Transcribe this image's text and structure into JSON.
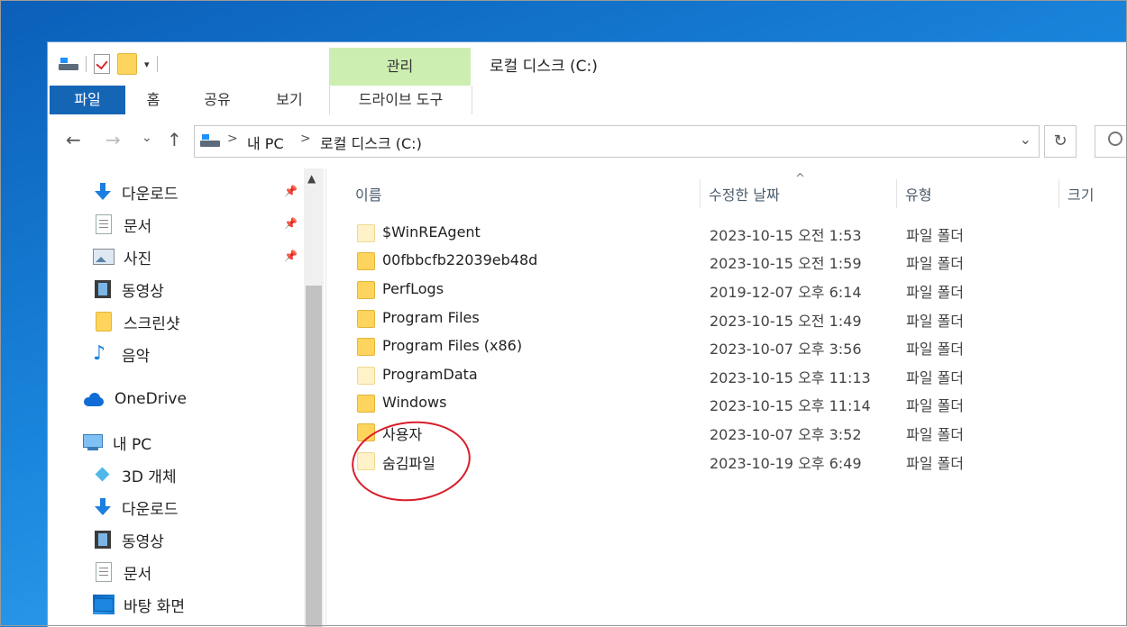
{
  "title": {
    "manage_tab": "관리",
    "window_title": "로컬 디스크 (C:)"
  },
  "ribbon": {
    "tabs": [
      "파일",
      "홈",
      "공유",
      "보기",
      "드라이브 도구"
    ]
  },
  "address": {
    "crumbs": [
      "내 PC",
      "로컬 디스크 (C:)"
    ],
    "separator": ">",
    "back": "←",
    "forward": "→",
    "recent": "⌄",
    "up": "↑",
    "dropdown": "⌄",
    "refresh": "↻"
  },
  "nav": {
    "quick": [
      {
        "label": "다운로드",
        "icon": "download-icon",
        "pinned": true
      },
      {
        "label": "문서",
        "icon": "document-icon",
        "pinned": true
      },
      {
        "label": "사진",
        "icon": "picture-icon",
        "pinned": true
      },
      {
        "label": "동영상",
        "icon": "video-icon",
        "pinned": false
      },
      {
        "label": "스크린샷",
        "icon": "folder-icon",
        "pinned": false
      },
      {
        "label": "음악",
        "icon": "music-icon",
        "pinned": false
      }
    ],
    "onedrive": "OneDrive",
    "pc": "내 PC",
    "pc_items": [
      {
        "label": "3D 개체",
        "icon": "3d-objects-icon"
      },
      {
        "label": "다운로드",
        "icon": "download-icon"
      },
      {
        "label": "동영상",
        "icon": "video-icon"
      },
      {
        "label": "문서",
        "icon": "document-icon"
      },
      {
        "label": "바탕 화면",
        "icon": "desktop-icon"
      }
    ],
    "pin_glyph": "📌",
    "scroll_up": "▲"
  },
  "list": {
    "columns": [
      "이름",
      "수정한 날짜",
      "유형",
      "크기"
    ],
    "sort_glyph": "^",
    "rows": [
      {
        "name": "$WinREAgent",
        "date": "2023-10-15 오전 1:53",
        "type": "파일 폴더",
        "hidden": true
      },
      {
        "name": "00fbbcfb22039eb48d",
        "date": "2023-10-15 오전 1:59",
        "type": "파일 폴더",
        "hidden": false
      },
      {
        "name": "PerfLogs",
        "date": "2019-12-07 오후 6:14",
        "type": "파일 폴더",
        "hidden": false
      },
      {
        "name": "Program Files",
        "date": "2023-10-15 오전 1:49",
        "type": "파일 폴더",
        "hidden": false
      },
      {
        "name": "Program Files (x86)",
        "date": "2023-10-07 오후 3:56",
        "type": "파일 폴더",
        "hidden": false
      },
      {
        "name": "ProgramData",
        "date": "2023-10-15 오후 11:13",
        "type": "파일 폴더",
        "hidden": true
      },
      {
        "name": "Windows",
        "date": "2023-10-15 오후 11:14",
        "type": "파일 폴더",
        "hidden": false
      },
      {
        "name": "사용자",
        "date": "2023-10-07 오후 3:52",
        "type": "파일 폴더",
        "hidden": false
      },
      {
        "name": "숨김파일",
        "date": "2023-10-19 오후 6:49",
        "type": "파일 폴더",
        "hidden": true
      }
    ]
  }
}
